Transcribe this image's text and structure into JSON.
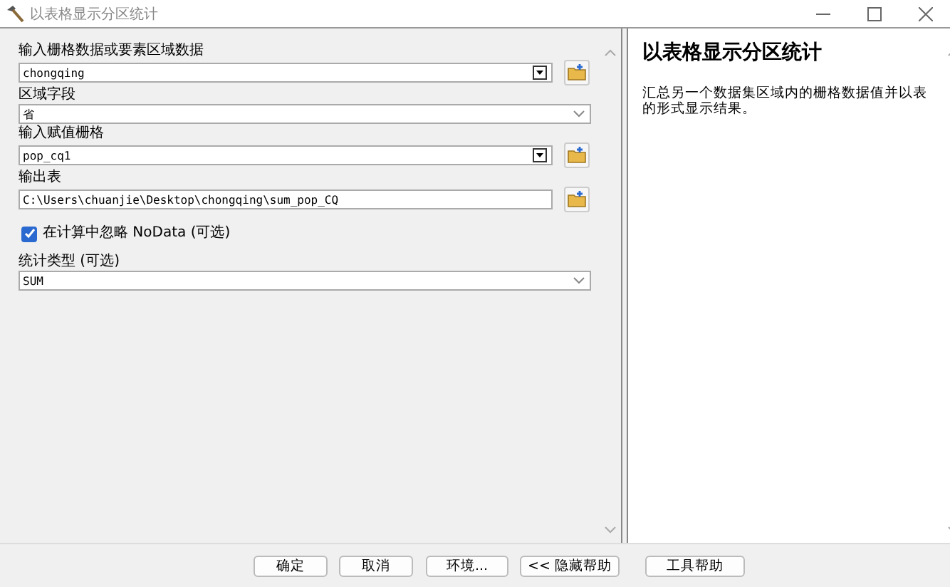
{
  "window": {
    "title": "以表格显示分区统计"
  },
  "parameters": [
    {
      "kind": "combo",
      "label": "输入栅格数据或要素区域数据",
      "value": "chongqing"
    },
    {
      "kind": "dropdown",
      "label": "区域字段",
      "value": "省"
    },
    {
      "kind": "combo",
      "label": "输入赋值栅格",
      "value": "pop_cq1"
    },
    {
      "kind": "text",
      "label": "输出表",
      "value": "C:\\Users\\chuanjie\\Desktop\\chongqing\\sum_pop_CQ"
    },
    {
      "kind": "checkbox",
      "label": "在计算中忽略 NoData (可选)",
      "checked": true
    },
    {
      "kind": "dropdown",
      "label": "统计类型 (可选)",
      "value": "SUM"
    }
  ],
  "help": {
    "title": "以表格显示分区统计",
    "text": "汇总另一个数据集区域内的栅格数据值并以表的形式显示结果。"
  },
  "buttons": [
    "确定",
    "取消",
    "环境...",
    "<< 隐藏帮助",
    "工具帮助"
  ]
}
